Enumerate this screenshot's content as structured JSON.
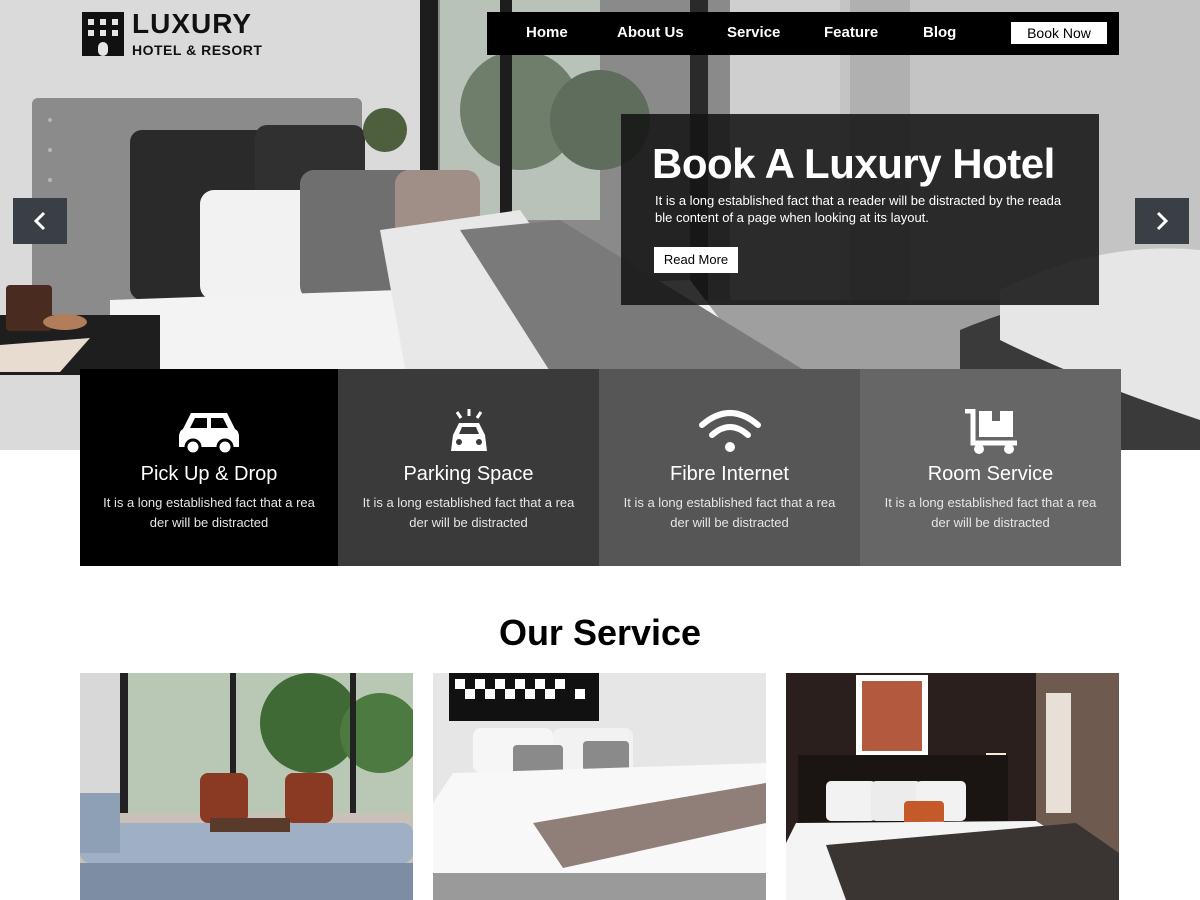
{
  "logo": {
    "title": "LUXURY",
    "subtitle": "HOTEL & RESORT"
  },
  "nav": {
    "items": [
      "Home",
      "About Us",
      "Service",
      "Feature",
      "Blog"
    ],
    "book_label": "Book Now"
  },
  "banner": {
    "title": "Book A Luxury Hotel",
    "text": "It is a long established fact that a reader will be distracted by the reada ble content of a page when looking at its layout.",
    "button_label": "Read More"
  },
  "features": [
    {
      "icon": "car-icon",
      "title": "Pick Up & Drop",
      "desc": "It is a long established fact that a rea der will be distracted"
    },
    {
      "icon": "police-car-icon",
      "title": "Parking Space",
      "desc": "It is a long established fact that a rea der will be distracted"
    },
    {
      "icon": "wifi-icon",
      "title": "Fibre Internet",
      "desc": "It is a long established fact that a rea der will be distracted"
    },
    {
      "icon": "luggage-cart-icon",
      "title": "Room Service",
      "desc": "It is a long established fact that a rea der will be distracted"
    }
  ],
  "services": {
    "title": "Our Service"
  },
  "colors": {
    "nav_bg": "#000000",
    "banner_bg": "#141414",
    "feature_1": "#000000",
    "feature_2": "#3a3a3a",
    "feature_3": "#565656",
    "feature_4": "#666666",
    "arrow_bg": "#3a3f45"
  }
}
